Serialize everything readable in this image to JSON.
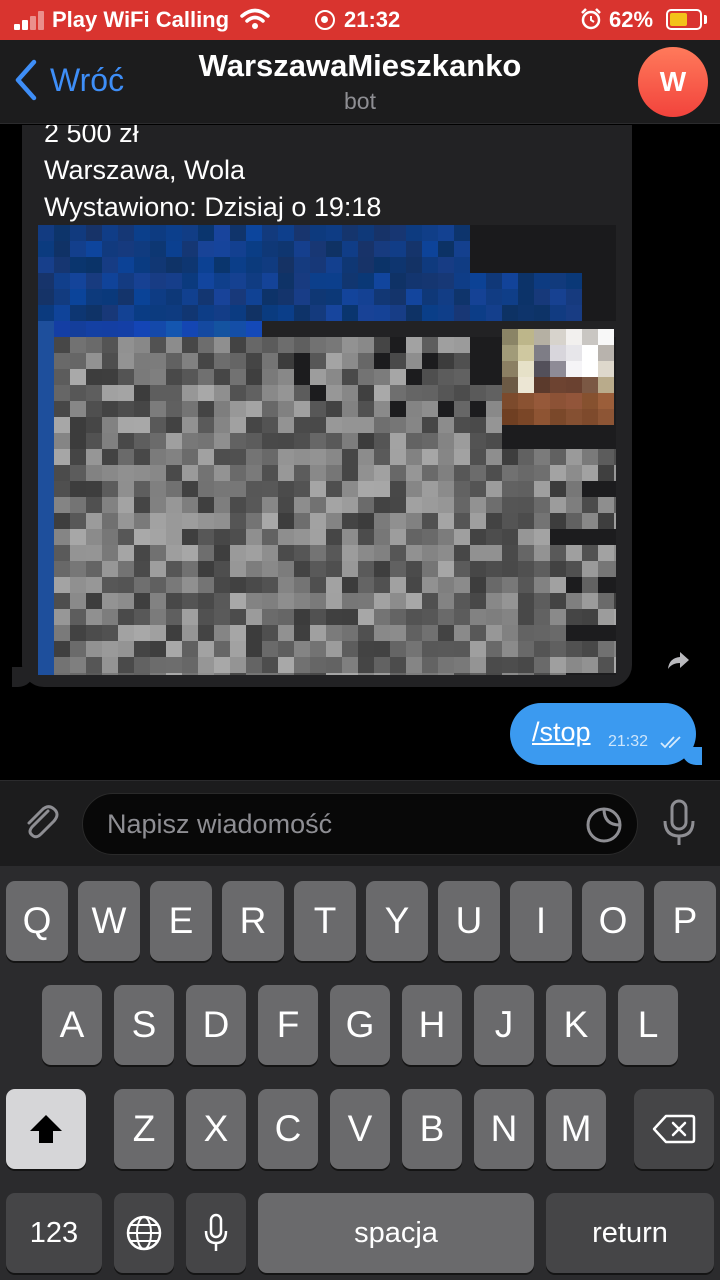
{
  "status_bar": {
    "carrier": "Play WiFi Calling",
    "time": "21:32",
    "battery_percent": "62%",
    "battery_level": 0.62,
    "bg_color": "#d9342f"
  },
  "header": {
    "back_label": "Wróć",
    "title": "WarszawaMieszkanko",
    "subtitle": "bot",
    "avatar_letter": "W",
    "accent_color": "#3e8ef7"
  },
  "messages": {
    "incoming": {
      "lines": [
        "2 500 zł",
        "Warszawa, Wola",
        "Wystawiono: Dzisiaj o 19:18"
      ]
    },
    "outgoing": {
      "text": "/stop",
      "time": "21:32",
      "bubble_color": "#3b9af0"
    }
  },
  "composer": {
    "placeholder": "Napisz wiadomość"
  },
  "keyboard": {
    "row1": [
      "Q",
      "W",
      "E",
      "R",
      "T",
      "Y",
      "U",
      "I",
      "O",
      "P"
    ],
    "row2": [
      "A",
      "S",
      "D",
      "F",
      "G",
      "H",
      "J",
      "K",
      "L"
    ],
    "row3": [
      "Z",
      "X",
      "C",
      "V",
      "B",
      "N",
      "M"
    ],
    "numbers_label": "123",
    "space_label": "spacja",
    "return_label": "return"
  },
  "icons": {
    "back": "chevron-left-icon",
    "forward": "share-arrow-icon",
    "attach": "paperclip-icon",
    "sticker": "sticker-icon",
    "mic": "microphone-icon",
    "shift": "shift-arrow-icon",
    "backspace": "backspace-icon",
    "globe": "globe-icon"
  }
}
